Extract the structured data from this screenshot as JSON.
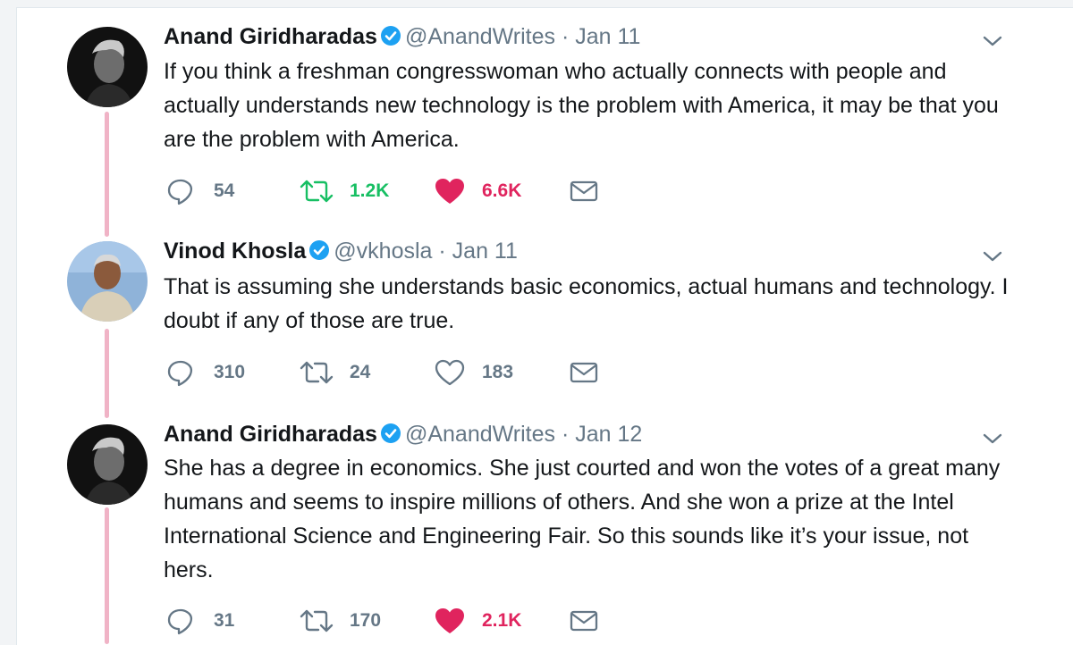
{
  "colors": {
    "thread_line": "#f0b3c6",
    "verified": "#1da1f2",
    "retweet_active": "#17bf63",
    "like_active": "#e0245e",
    "muted": "#657786"
  },
  "tweets": [
    {
      "name": "Anand Giridharadas",
      "handle": "@AnandWrites",
      "separator": "·",
      "date": "Jan 11",
      "verified": true,
      "text": "If you think a freshman congresswoman who actually connects with people and actually understands new technology is the problem with America, it may be that you are the problem with America.",
      "replies": "54",
      "retweets": "1.2K",
      "likes": "6.6K",
      "retweeted": true,
      "liked": true,
      "icons": [
        "reply-icon",
        "retweet-icon",
        "heart-icon",
        "direct-message-icon",
        "chevron-down-icon",
        "verified-badge-icon"
      ]
    },
    {
      "name": "Vinod Khosla",
      "handle": "@vkhosla",
      "separator": "·",
      "date": "Jan 11",
      "verified": true,
      "text": "That is assuming she understands basic economics, actual humans and technology. I doubt if any of those are true.",
      "replies": "310",
      "retweets": "24",
      "likes": "183",
      "retweeted": false,
      "liked": false,
      "icons": [
        "reply-icon",
        "retweet-icon",
        "heart-outline-icon",
        "direct-message-icon",
        "chevron-down-icon",
        "verified-badge-icon"
      ]
    },
    {
      "name": "Anand Giridharadas",
      "handle": "@AnandWrites",
      "separator": "·",
      "date": "Jan 12",
      "verified": true,
      "text": "She has a degree in economics. She just courted and won the votes of a great many humans and seems to inspire millions of others. And she won a prize at the Intel International Science and Engineering Fair. So this sounds like it’s your issue, not hers.",
      "replies": "31",
      "retweets": "170",
      "likes": "2.1K",
      "retweeted": false,
      "liked": true,
      "icons": [
        "reply-icon",
        "retweet-icon",
        "heart-icon",
        "direct-message-icon",
        "chevron-down-icon",
        "verified-badge-icon"
      ]
    }
  ]
}
